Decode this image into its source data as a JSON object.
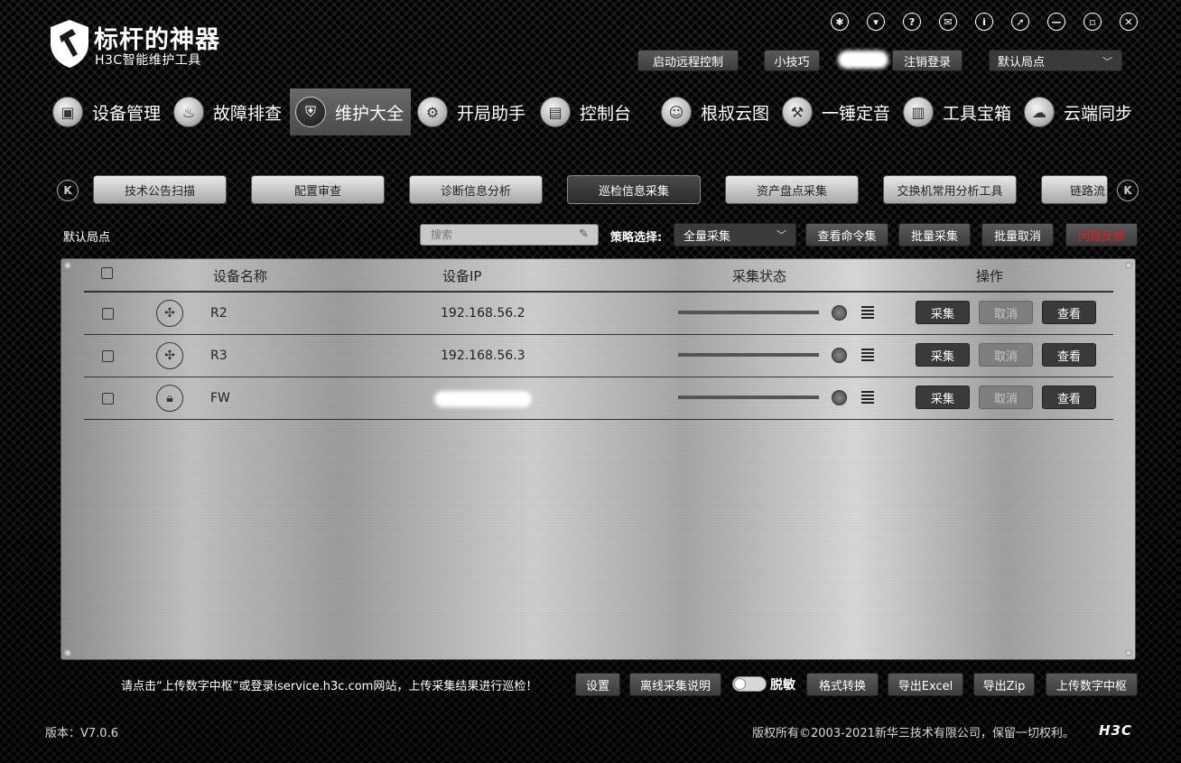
{
  "app": {
    "title": "标杆的神器",
    "subtitle": "H3C智能维护工具"
  },
  "window_icons": [
    "gear-icon",
    "shirt-icon",
    "help-icon",
    "mail-icon",
    "info-icon",
    "pin-icon",
    "minimize-icon",
    "maximize-icon",
    "close-icon"
  ],
  "top_bar": {
    "remote_control": "启动远程控制",
    "tips": "小技巧",
    "logout": "注销登录",
    "site_select": "默认局点"
  },
  "main_nav": [
    {
      "label": "设备管理",
      "icon": "device-manage-icon"
    },
    {
      "label": "故障排查",
      "icon": "fire-extinguisher-icon"
    },
    {
      "label": "维护大全",
      "icon": "shield-icon",
      "active": true
    },
    {
      "label": "开局助手",
      "icon": "gear-icon"
    },
    {
      "label": "控制台",
      "icon": "console-icon"
    },
    {
      "label": "根叔云图",
      "icon": "avatar-icon"
    },
    {
      "label": "一锤定音",
      "icon": "hammer-icon"
    },
    {
      "label": "工具宝箱",
      "icon": "toolbox-icon"
    },
    {
      "label": "云端同步",
      "icon": "cloud-sync-icon"
    }
  ],
  "sub_tabs": [
    {
      "label": "技术公告扫描"
    },
    {
      "label": "配置审查"
    },
    {
      "label": "诊断信息分析"
    },
    {
      "label": "巡检信息采集",
      "active": true
    },
    {
      "label": "资产盘点采集"
    },
    {
      "label": "交换机常用分析工具"
    },
    {
      "label": "链路流"
    }
  ],
  "toolbar": {
    "site_label": "默认局点",
    "search_placeholder": "搜索",
    "strategy_label": "策略选择:",
    "strategy_value": "全量采集",
    "view_commands": "查看命令集",
    "batch_collect": "批量采集",
    "batch_cancel": "批量取消",
    "feedback": "问题反馈"
  },
  "table": {
    "headers": {
      "name": "设备名称",
      "ip": "设备IP",
      "status": "采集状态",
      "ops": "操作"
    },
    "rows": [
      {
        "name": "R2",
        "ip": "192.168.56.2",
        "icon": "router-icon",
        "progress": 0,
        "collect": "采集",
        "cancel": "取消",
        "view": "查看"
      },
      {
        "name": "R3",
        "ip": "192.168.56.3",
        "icon": "router-icon",
        "progress": 0,
        "collect": "采集",
        "cancel": "取消",
        "view": "查看"
      },
      {
        "name": "FW",
        "ip": "",
        "icon": "firewall-lock-icon",
        "progress": 0,
        "collect": "采集",
        "cancel": "取消",
        "view": "查看"
      }
    ]
  },
  "bottom": {
    "notice": "请点击“上传数字中枢”或登录iservice.h3c.com网站，上传采集结果进行巡检！",
    "settings": "设置",
    "offline_help": "离线采集说明",
    "desensitize": "脱敏",
    "format_convert": "格式转换",
    "export_excel": "导出Excel",
    "export_zip": "导出Zip",
    "upload": "上传数字中枢"
  },
  "footer": {
    "version": "版本：V7.0.6",
    "copyright": "版权所有©2003-2021新华三技术有限公司，保留一切权利。",
    "brand": "H3C"
  }
}
